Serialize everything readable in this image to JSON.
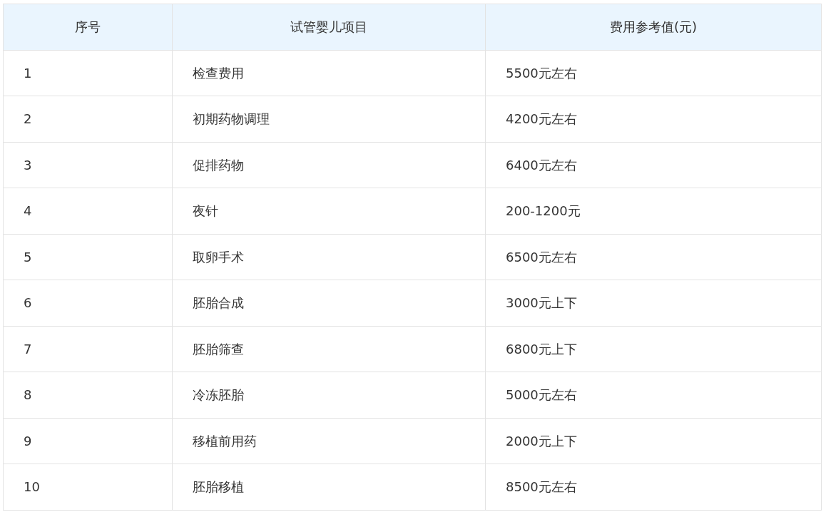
{
  "table": {
    "columns": [
      "序号",
      "试管婴儿项目",
      "费用参考值(元)"
    ],
    "rows": [
      [
        "1",
        "检查费用",
        "5500元左右"
      ],
      [
        "2",
        "初期药物调理",
        "4200元左右"
      ],
      [
        "3",
        "促排药物",
        "6400元左右"
      ],
      [
        "4",
        "夜针",
        "200-1200元"
      ],
      [
        "5",
        "取卵手术",
        "6500元左右"
      ],
      [
        "6",
        "胚胎合成",
        "3000元上下"
      ],
      [
        "7",
        "胚胎筛查",
        "6800元上下"
      ],
      [
        "8",
        "冷冻胚胎",
        "5000元左右"
      ],
      [
        "9",
        "移植前用药",
        "2000元上下"
      ],
      [
        "10",
        "胚胎移植",
        "8500元左右"
      ]
    ]
  }
}
